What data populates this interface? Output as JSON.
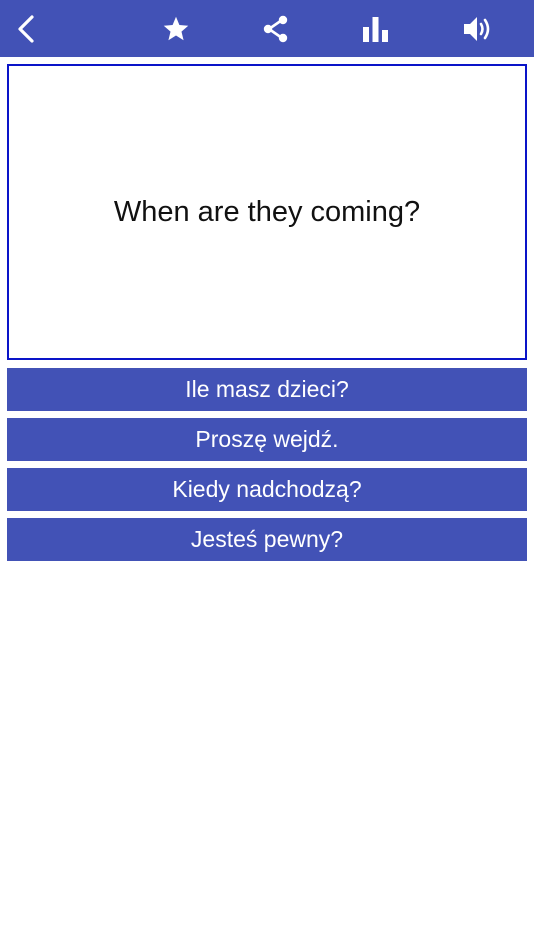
{
  "toolbar": {
    "background": "#4252b6",
    "icons": [
      "back-chevron-icon",
      "star-icon",
      "share-icon",
      "bar-chart-icon",
      "speaker-icon"
    ]
  },
  "question": {
    "text": "When are they coming?",
    "border_color": "#0a14c8"
  },
  "answers": [
    {
      "label": "Ile masz dzieci?"
    },
    {
      "label": "Proszę wejdź."
    },
    {
      "label": "Kiedy nadchodzą?"
    },
    {
      "label": "Jesteś pewny?"
    }
  ],
  "colors": {
    "accent": "#4252b6",
    "answer_text": "#ffffff",
    "question_text": "#111111"
  }
}
